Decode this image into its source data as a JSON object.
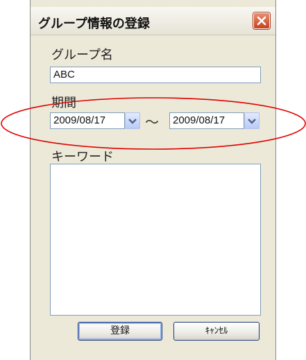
{
  "window": {
    "title": "グループ情報の登録"
  },
  "group_name": {
    "label": "グループ名",
    "value": "ABC"
  },
  "period": {
    "label": "期間",
    "start_date": "2009/08/17",
    "separator": "～",
    "end_date": "2009/08/17"
  },
  "keyword": {
    "label": "キーワード",
    "value": ""
  },
  "buttons": {
    "register": "登録",
    "cancel": "ｷｬﾝｾﾙ"
  },
  "colors": {
    "highlight_ellipse": "#e00000",
    "close_button": "#c6411d"
  },
  "icons": {
    "close": "close-icon",
    "dropdown": "chevron-down-icon"
  }
}
